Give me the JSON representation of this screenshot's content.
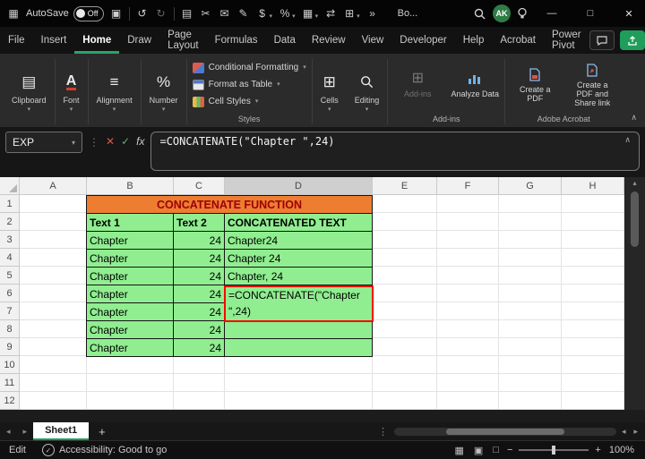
{
  "titlebar": {
    "autosave_label": "AutoSave",
    "autosave_state": "Off",
    "doc_name": "Bo...",
    "avatar": "AK"
  },
  "icons": {
    "app": "▦",
    "save": "▣",
    "undo": "↺",
    "redo": "↻",
    "copy": "▤",
    "cut": "✂",
    "mail": "✉",
    "format_painter": "✎",
    "borders": "⊞",
    "accounting": "$",
    "percent": "%",
    "merge": "▦",
    "switch": "⇄",
    "more": "»",
    "caret": "▾",
    "minimize": "—",
    "maximize": "□",
    "close": "✕",
    "dots": "⋮",
    "cancel": "✕",
    "enter": "✓",
    "fx": "fx",
    "collapse": "∧",
    "scroll_up": "▴",
    "scroll_left": "◂",
    "scroll_right": "▸",
    "add": "+",
    "zoom_out": "−",
    "zoom_in": "+",
    "view_normal": "▦",
    "view_layout": "▣",
    "view_break": "□",
    "check": "✓",
    "clipboard": "▤",
    "font": "A",
    "alignment": "≡",
    "number": "%",
    "cells": "⊞",
    "addins": "⊞"
  },
  "menubar": {
    "items": [
      "File",
      "Insert",
      "Home",
      "Draw",
      "Page Layout",
      "Formulas",
      "Data",
      "Review",
      "View",
      "Developer",
      "Help",
      "Acrobat",
      "Power Pivot"
    ],
    "active": "Home"
  },
  "ribbon": {
    "groups": [
      {
        "label": "Clipboard"
      },
      {
        "label": "Font"
      },
      {
        "label": "Alignment"
      },
      {
        "label": "Number"
      }
    ],
    "styles_items": [
      "Conditional Formatting",
      "Format as Table",
      "Cell Styles"
    ],
    "styles_label": "Styles",
    "cells_label": "Cells",
    "editing_label": "Editing",
    "addins_items": [
      "Add-ins",
      "Analyze Data"
    ],
    "addins_label": "Add-ins",
    "acrobat_items": [
      "Create a PDF",
      "Create a PDF and Share link"
    ],
    "acrobat_label": "Adobe Acrobat"
  },
  "formula_bar": {
    "name_box": "EXP",
    "formula": "=CONCATENATE(\"Chapter \",24)"
  },
  "sheet": {
    "columns": [
      "A",
      "B",
      "C",
      "D",
      "E",
      "F",
      "G",
      "H"
    ],
    "active_column": "D",
    "row_count": 12,
    "colors": {
      "header_fill": "#ED7D31",
      "header_text": "#9C0006",
      "table_fill": "#90EE90",
      "edit_border": "#FF0000"
    },
    "table": {
      "title": "CONCATENATE FUNCTION",
      "col_headers": [
        "Text 1",
        "Text 2",
        "CONCATENATED TEXT"
      ],
      "rows": [
        [
          "Chapter",
          "24",
          "Chapter24"
        ],
        [
          "Chapter",
          "24",
          "Chapter 24"
        ],
        [
          "Chapter",
          "24",
          "Chapter, 24"
        ],
        [
          "Chapter",
          "24",
          ""
        ],
        [
          "Chapter",
          "24",
          ""
        ],
        [
          "Chapter",
          "24",
          ""
        ],
        [
          "Chapter",
          "24",
          ""
        ]
      ],
      "editing_cell": {
        "line1": "=CONCATENATE(\"Chapter",
        "line2": "\",24)"
      }
    }
  },
  "tabs": {
    "sheet": "Sheet1"
  },
  "status": {
    "mode": "Edit",
    "accessibility": "Accessibility: Good to go",
    "zoom": "100%"
  }
}
